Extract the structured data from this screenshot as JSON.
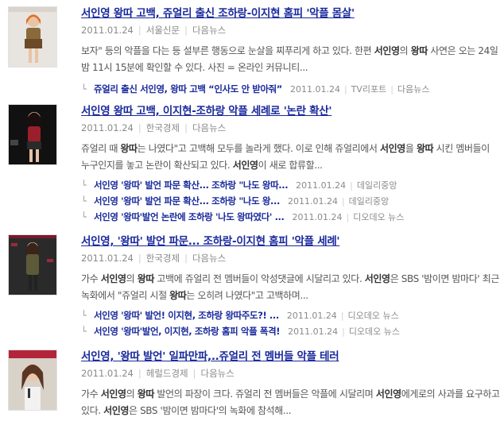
{
  "articles": [
    {
      "title": "서인영 왕따 고백, 쥬얼리 출신 조하랑-이지현 홈피 '악플 몸살'",
      "date": "2011.01.24",
      "publisher": "서울신문",
      "source": "다음뉴스",
      "summary": "보자\" 등의 악플을 다는 등 설부른 행동으로 눈살을 찌푸리게 하고 있다. 한편 서인영의 왕따 사연은 오는 24일 밤 11시 15분에 확인할 수 있다. 사진 = 온라인 커뮤니티...",
      "related": [
        {
          "title": "쥬얼리 출신 서인영, 왕따 고백 “인사도 안 받아줘”",
          "date": "2011.01.24",
          "publisher": "TV리포트",
          "source": "다음뉴스"
        }
      ]
    },
    {
      "title": "서인영 왕따 고백, 이지현-조하랑 악플 세례로 '논란 확산'",
      "date": "2011.01.24",
      "publisher": "한국경제",
      "source": "다음뉴스",
      "summary": "쥬얼리 때 왕따는 나였다\"고 고백해 모두를 놀라게 했다. 이로 인해 쥬얼리에서 서인영을 왕따 시킨 멤버들이 누구인지를 놓고 논란이 확산되고 있다. 서인영이 새로 합류할...",
      "related": [
        {
          "title": "서인영 '왕따' 발언 파문 확산... 조하랑 \"나도 왕따...",
          "date": "2011.01.24",
          "publisher": "데일리중앙",
          "source": ""
        },
        {
          "title": "서인영 '왕따' 발언 파문 확산... 조하랑 \"나도 왕...",
          "date": "2011.01.24",
          "publisher": "데일리중앙",
          "source": ""
        },
        {
          "title": "서인영 '왕따'발언 논란에 조하랑 '나도 왕따였다' ...",
          "date": "2011.01.24",
          "publisher": "디오데오 뉴스",
          "source": ""
        }
      ]
    },
    {
      "title": "서인영, '왕따' 발언 파문... 조하랑-이지현 홈피 '악플 세례'",
      "date": "2011.01.24",
      "publisher": "한국경제",
      "source": "다음뉴스",
      "summary": "가수 서인영의 왕따 고백에 쥬얼리 전 멤버들이 악성댓글에 시달리고 있다. 서인영은 SBS '밤이면 밤마다' 최근 녹화에서 \"쥬얼리 시절 왕따는 오히려 나였다\"고 고백하며...",
      "related": [
        {
          "title": "서인영 '왕따' 발언! 이지현, 조하랑 왕따주도?! ...",
          "date": "2011.01.24",
          "publisher": "디오데오 뉴스",
          "source": ""
        },
        {
          "title": "서인영 '왕따'발언, 이지현, 조하랑 홈피 악플 폭격!",
          "date": "2011.01.24",
          "publisher": "디오데오 뉴스",
          "source": ""
        }
      ]
    },
    {
      "title": "서인영, '왕따 발언' 일파만파,..쥬얼리 전 멤버들 악플 테러",
      "date": "2011.01.24",
      "publisher": "헤럴드경제",
      "source": "다음뉴스",
      "summary": "가수 서인영의 왕따 발언의 파장이 크다. 쥬얼리 전 멤버들은 악플에 시달리며 서인영에게로의 사과를 요구하고 있다. 서인영은 SBS '밤이면 밤마다'의 녹화에 참석해...",
      "related": []
    }
  ],
  "keywords": [
    "서인영",
    "왕따"
  ],
  "related_mark": "└"
}
